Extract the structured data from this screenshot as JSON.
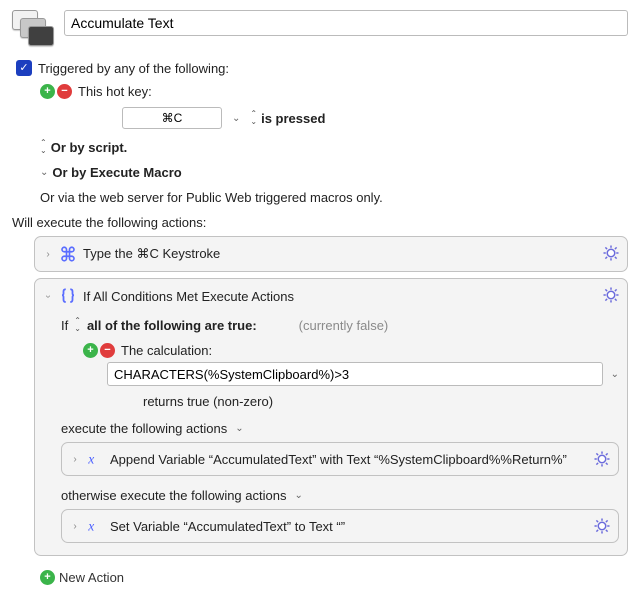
{
  "title": "Accumulate Text",
  "trigger_checkbox_label": "Triggered by any of the following:",
  "hotkey_heading": "This hot key:",
  "hotkey_value": "⌘C",
  "hotkey_state": "is pressed",
  "or_script": "Or by script.",
  "or_exec_macro": "Or by Execute Macro",
  "or_web": "Or via the web server for Public Web triggered macros only.",
  "will_execute": "Will execute the following actions:",
  "action_type_keystroke": "Type the ⌘C Keystroke",
  "if_title": "If All Conditions Met Execute Actions",
  "if_prefix": "If",
  "if_mode": "all of the following are true:",
  "if_currently": "(currently false)",
  "calc_heading": "The calculation:",
  "calc_value": "CHARACTERS(%SystemClipboard%)>3",
  "calc_returns": "returns true (non-zero)",
  "exec_following": "execute the following actions",
  "append_action": "Append Variable “AccumulatedText” with Text “%SystemClipboard%%Return%”",
  "otherwise": "otherwise execute the following actions",
  "set_action": "Set Variable “AccumulatedText” to Text “”",
  "new_action": "New Action"
}
